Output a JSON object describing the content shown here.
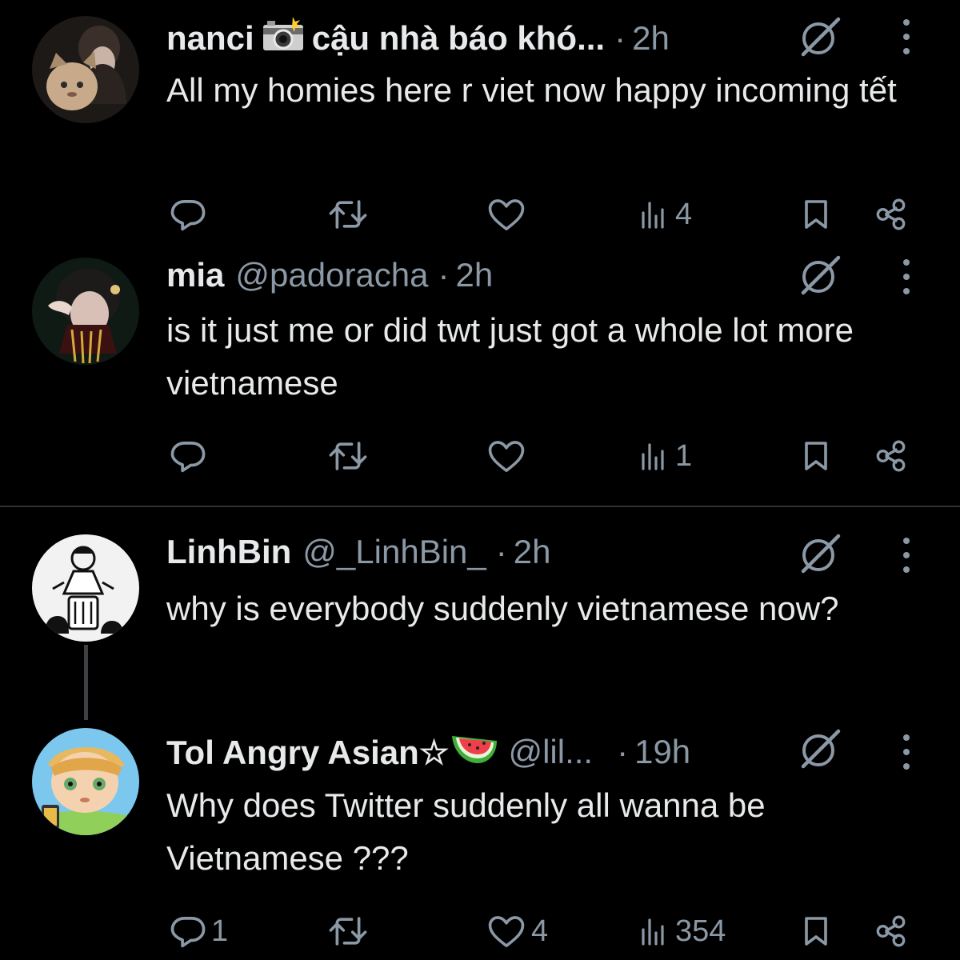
{
  "tweets": [
    {
      "name": "nanci",
      "handle": "cậu nhà báo khó...",
      "dot": "·",
      "time": "2h",
      "text": "All my homies here r viet now happy incoming tết",
      "replies": "",
      "retweets": "",
      "likes": "",
      "views": "4",
      "emoji": "camera-flash-icon"
    },
    {
      "name": "mia",
      "handle": "@padoracha",
      "dot": "·",
      "time": "2h",
      "text": "is it just me or did twt just got a whole lot more vietnamese",
      "replies": "",
      "retweets": "",
      "likes": "",
      "views": "1"
    },
    {
      "name": "LinhBin",
      "handle": "@_LinhBin_",
      "dot": "·",
      "time": "2h",
      "text": "why is everybody suddenly vietnamese now?"
    },
    {
      "name": "Tol Angry Asian☆",
      "handle": "@lil...",
      "dot": "·",
      "time": "19h",
      "text": "Why does Twitter suddenly all wanna be Vietnamese ???",
      "replies": "1",
      "retweets": "",
      "likes": "4",
      "views": "354",
      "emoji": "watermelon-icon"
    }
  ],
  "colors": {
    "background": "#000000",
    "text": "#e7e9ea",
    "secondary": "#8b98a5",
    "divider": "#2f3336"
  }
}
